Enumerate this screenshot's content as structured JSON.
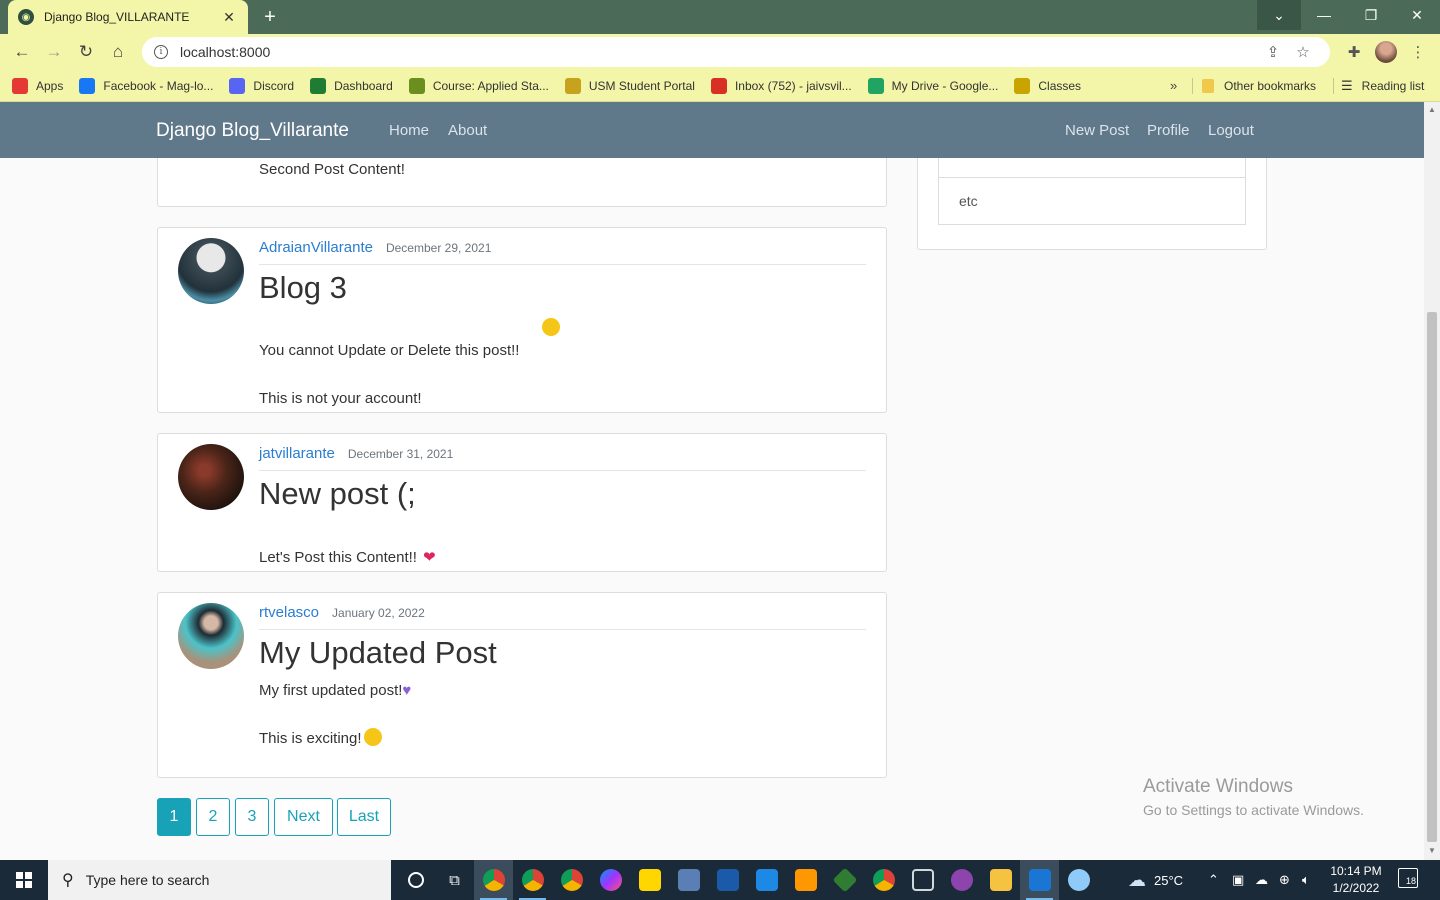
{
  "browser": {
    "tab_title": "Django Blog_VILLARANTE",
    "url": "localhost:8000",
    "bookmarks": [
      {
        "label": "Apps",
        "icon": "apps-grid-icon",
        "color": "#e53935"
      },
      {
        "label": "Facebook - Mag-lo...",
        "icon": "facebook-icon",
        "color": "#1877f2"
      },
      {
        "label": "Discord",
        "icon": "discord-icon",
        "color": "#5865f2"
      },
      {
        "label": "Dashboard",
        "icon": "usm-dashboard-icon",
        "color": "#1e7d32"
      },
      {
        "label": "Course: Applied Sta...",
        "icon": "course-icon",
        "color": "#6a8f1f"
      },
      {
        "label": "USM Student Portal",
        "icon": "usm-portal-icon",
        "color": "#c7a21c"
      },
      {
        "label": "Inbox (752) - jaivsvil...",
        "icon": "gmail-icon",
        "color": "#d93025"
      },
      {
        "label": "My Drive - Google...",
        "icon": "google-drive-icon",
        "color": "#1fa463"
      },
      {
        "label": "Classes",
        "icon": "classroom-icon",
        "color": "#c9a400"
      }
    ],
    "other_bookmarks": "Other bookmarks",
    "reading_list": "Reading list"
  },
  "site": {
    "brand": "Django Blog_Villarante",
    "nav_left": [
      "Home",
      "About"
    ],
    "nav_right": [
      "New Post",
      "Profile",
      "Logout"
    ]
  },
  "partial_post": {
    "content": "Second Post Content!"
  },
  "posts": [
    {
      "author": "AdraianVillarante",
      "date": "December 29, 2021",
      "title": "Blog 3",
      "content": "You cannot Update or Delete this post!!\n\nThis is not your account!",
      "emoji": "wink-emoji",
      "emoji_color": "#f5c518"
    },
    {
      "author": "jatvillarante",
      "date": "December 31, 2021",
      "title": "New post (;",
      "content": "Let's Post this Content!!",
      "emoji": "red-heart-emoji",
      "emoji_color": "#e0245e"
    },
    {
      "author": "rtvelasco",
      "date": "January 02, 2022",
      "title": "My Updated Post",
      "content_line1": "My first updated post!",
      "content_line2": "This is exciting!",
      "emoji": "purple-heart-emoji",
      "emoji_color": "#8a63d2",
      "emoji2": "smiling-emoji",
      "emoji2_color": "#f5c518"
    }
  ],
  "sidebar": {
    "last_item": "etc"
  },
  "pagination": [
    "1",
    "2",
    "3",
    "Next",
    "Last"
  ],
  "pagination_active": "1",
  "watermark": {
    "line1": "Activate Windows",
    "line2": "Go to Settings to activate Windows."
  },
  "taskbar": {
    "search_placeholder": "Type here to search",
    "weather": "25°C",
    "time": "10:14 PM",
    "date": "1/2/2022",
    "notifications": "18"
  }
}
